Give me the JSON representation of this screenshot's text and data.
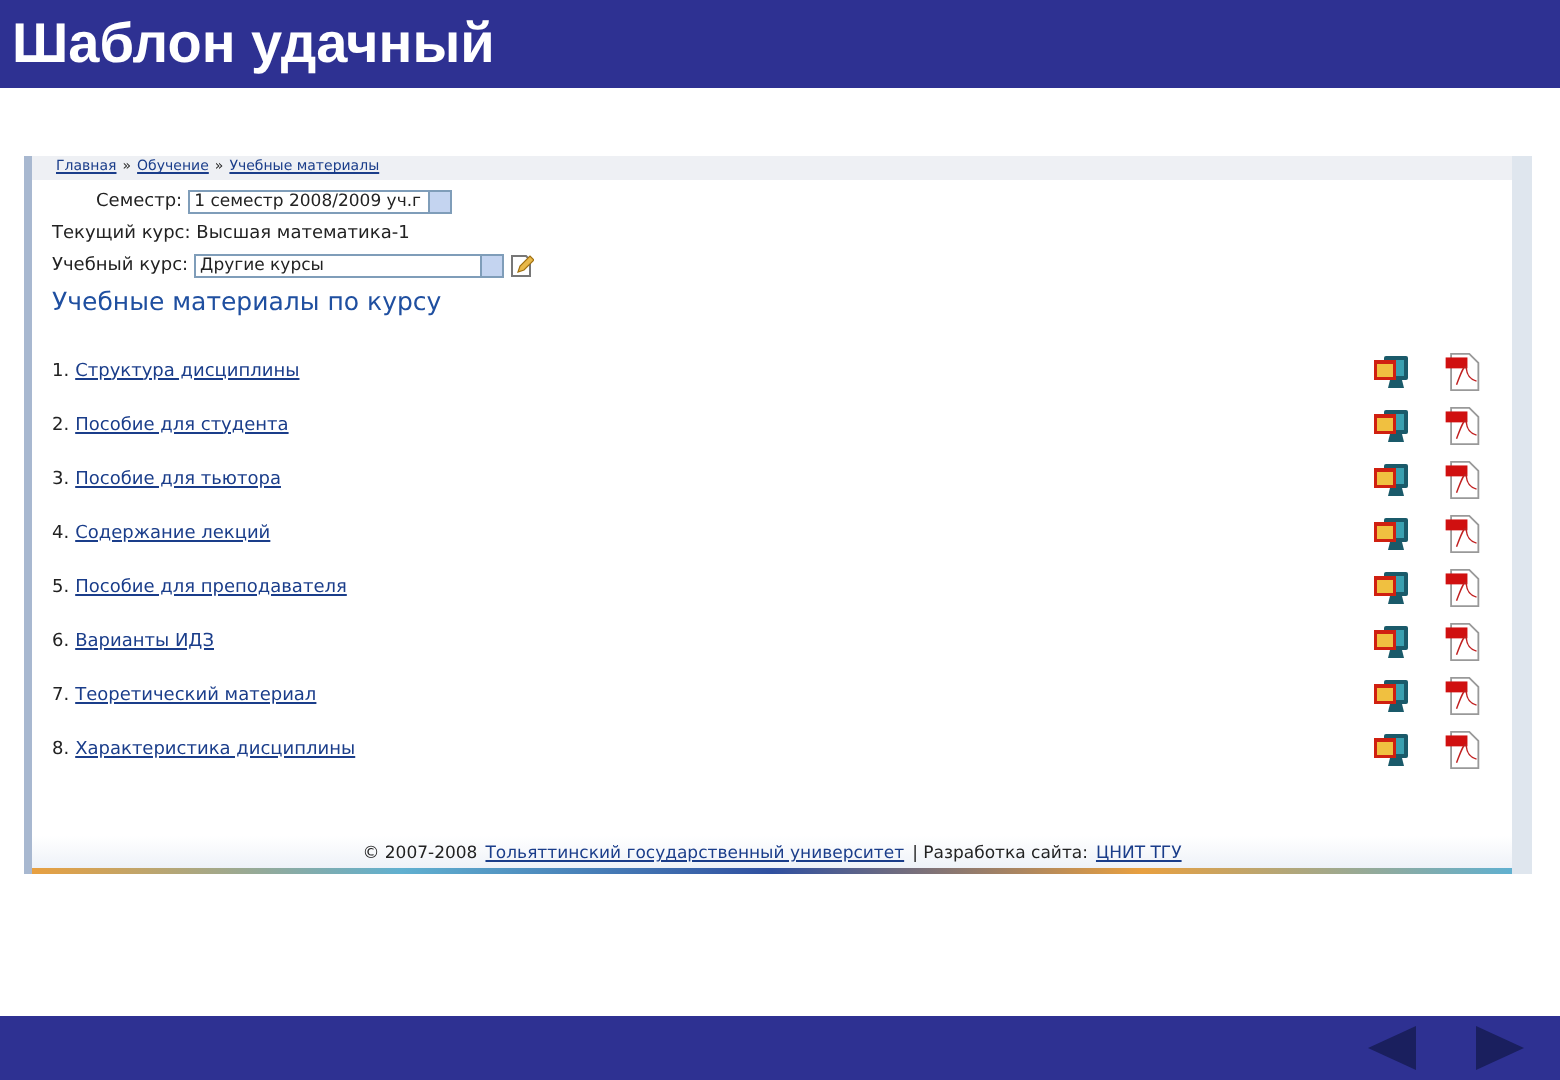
{
  "slide": {
    "title": "Шаблон удачный"
  },
  "breadcrumb": [
    "Главная",
    "Обучение",
    "Учебные материалы"
  ],
  "breadcrumb_separator": "»",
  "semester": {
    "label": "Семестр:",
    "value": "1 семестр 2008/2009 уч.г"
  },
  "current_course": "Текущий курс: Высшая математика-1",
  "course": {
    "label": "Учебный курс:",
    "value": "Другие курсы"
  },
  "heading": "Учебные материалы по курсу",
  "materials": [
    {
      "number": "1.",
      "label": "Структура дисциплины"
    },
    {
      "number": "2.",
      "label": "Пособие для студента"
    },
    {
      "number": "3.",
      "label": "Пособие для тьютора"
    },
    {
      "number": "4.",
      "label": "Содержание лекций"
    },
    {
      "number": "5.",
      "label": "Пособие для преподавателя"
    },
    {
      "number": "6.",
      "label": "Варианты ИДЗ"
    },
    {
      "number": "7.",
      "label": "Теоретический материал"
    },
    {
      "number": "8.",
      "label": "Характеристика дисциплины"
    }
  ],
  "footer": {
    "copyright": "© 2007-2008",
    "university": "Тольяттинский государственный университет",
    "separator": "| Разработка сайта:",
    "developer": "ЦНИТ ТГУ"
  }
}
